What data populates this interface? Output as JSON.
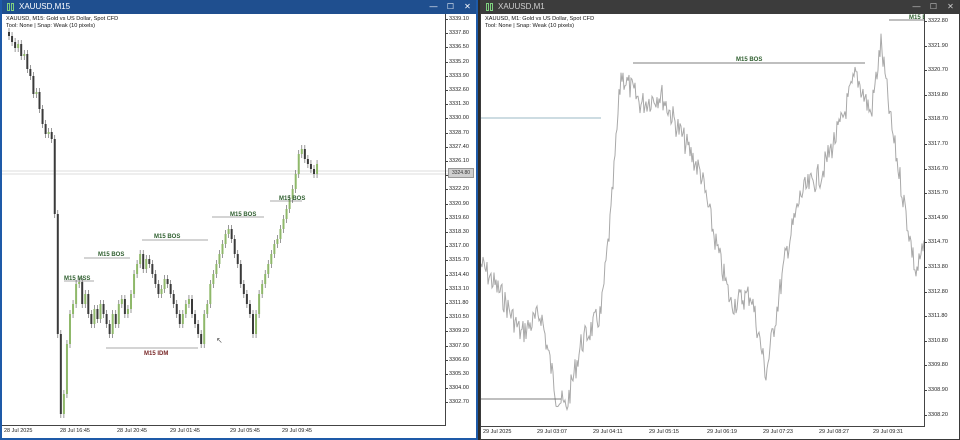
{
  "left_window": {
    "title": "XAUUSD,M15",
    "info_line1": "XAUUSD, M15:  Gold vs US Dollar, Spot CFD",
    "info_line2": "Tool: None | Snap: Weak (10 pixels)",
    "buttons": {
      "minimize": "—",
      "maximize": "☐",
      "close": "✕"
    },
    "price_labels": [
      "3339.10",
      "3337.80",
      "3336.50",
      "3335.20",
      "3333.90",
      "3332.60",
      "3331.30",
      "3330.00",
      "3328.70",
      "3327.40",
      "3326.10",
      "3323.50",
      "3322.20",
      "3320.90",
      "3319.60",
      "3318.30",
      "3317.00",
      "3315.70",
      "3314.40",
      "3313.10",
      "3311.80",
      "3310.50",
      "3309.20",
      "3307.90",
      "3306.60",
      "3305.30",
      "3304.00",
      "3302.70"
    ],
    "current_price_tag": "3324.80",
    "time_labels": [
      "28 Jul 2025",
      "28 Jul 16:45",
      "28 Jul 20:45",
      "29 Jul 01:45",
      "29 Jul 05:45",
      "29 Jul 09:45"
    ],
    "annotations": {
      "bos1": "M15 BOS",
      "bos2": "M15 BOS",
      "bos3": "M15 BOS",
      "bos4": "M15 BOS",
      "mss": "M15 MSS",
      "idm": "M15 IDM"
    },
    "colors": {
      "bull": "#8fb86a",
      "bear": "#3a3a3a",
      "annotation": "#2f5f2f",
      "idm": "#7a2a2a"
    }
  },
  "right_window": {
    "title": "XAUUSD,M1",
    "info_line1": "XAUUSD, M1:  Gold vs US Dollar, Spot CFD",
    "info_line2": "Tool: None | Snap: Weak (10 pixels)",
    "buttons": {
      "minimize": "—",
      "maximize": "☐",
      "close": "✕"
    },
    "price_labels": [
      "3322.80",
      "3321.90",
      "3320.70",
      "3319.80",
      "3318.70",
      "3317.70",
      "3316.70",
      "3315.70",
      "3314.90",
      "3314.70",
      "3313.80",
      "3312.80",
      "3311.80",
      "3310.80",
      "3309.80",
      "3308.90",
      "3308.20"
    ],
    "time_labels": [
      "29 Jul 2025",
      "29 Jul 03:07",
      "29 Jul 04:11",
      "29 Jul 05:15",
      "29 Jul 06:19",
      "29 Jul 07:23",
      "29 Jul 08:27",
      "29 Jul 09:31",
      "29 Jul 10:35"
    ],
    "annotations": {
      "bos_mid": "M15 BOS",
      "bos_top": "M15 B"
    },
    "colors": {
      "line": "#a9a9a9",
      "accent": "#7fbf6a"
    }
  }
}
